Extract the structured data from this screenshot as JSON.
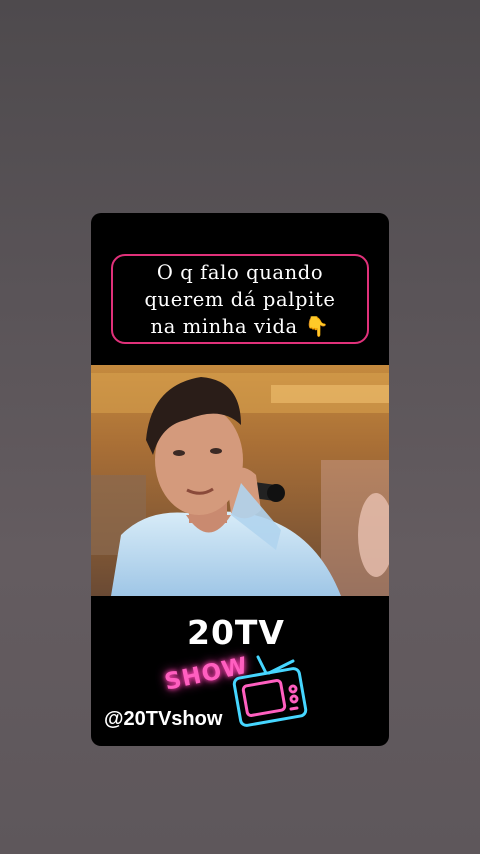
{
  "story": {
    "caption": "O q falo quando\nquerem dá palpite\nna minha vida 👇",
    "brand_title": "20TV",
    "show_label": "SHOW",
    "handle": "@20TVshow"
  },
  "colors": {
    "caption_border": "#e0317a",
    "show_neon": "#ff5fc0",
    "tv_neon_blue": "#46d6ff",
    "card_bg": "#000000"
  },
  "icons": {
    "tv": "retro-tv-icon"
  }
}
